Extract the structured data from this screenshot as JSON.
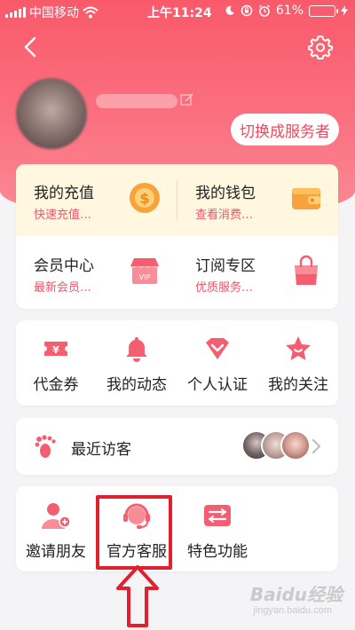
{
  "status_bar": {
    "carrier": "中国移动",
    "time": "上午11:24",
    "battery": "61%",
    "battery_level": 0.61
  },
  "header": {
    "switch_button": "切换成服务者"
  },
  "wallet": {
    "items": [
      {
        "title": "我的充值",
        "subtitle": "快速充值…",
        "icon": "coin-icon"
      },
      {
        "title": "我的钱包",
        "subtitle": "查看消费…",
        "icon": "wallet-icon"
      },
      {
        "title": "会员中心",
        "subtitle": "最新会员…",
        "icon": "vip-shop-icon"
      },
      {
        "title": "订阅专区",
        "subtitle": "优质服务…",
        "icon": "shopping-bag-icon"
      }
    ]
  },
  "menu": {
    "items": [
      {
        "label": "代金券",
        "icon": "ticket-icon"
      },
      {
        "label": "我的动态",
        "icon": "bell-icon"
      },
      {
        "label": "个人认证",
        "icon": "heart-badge-icon"
      },
      {
        "label": "我的关注",
        "icon": "star-icon"
      }
    ]
  },
  "visitors": {
    "label": "最近访客"
  },
  "tools": {
    "items": [
      {
        "label": "邀请朋友",
        "icon": "add-friend-icon"
      },
      {
        "label": "官方客服",
        "icon": "headset-icon"
      },
      {
        "label": "特色功能",
        "icon": "sliders-icon"
      }
    ]
  },
  "watermark": {
    "text": "Baidu经验",
    "sub": "jingyan.baidu.com"
  },
  "colors": {
    "brand": "#f95a6a",
    "accent_text": "#f0556a",
    "highlight": "#e0202e"
  }
}
